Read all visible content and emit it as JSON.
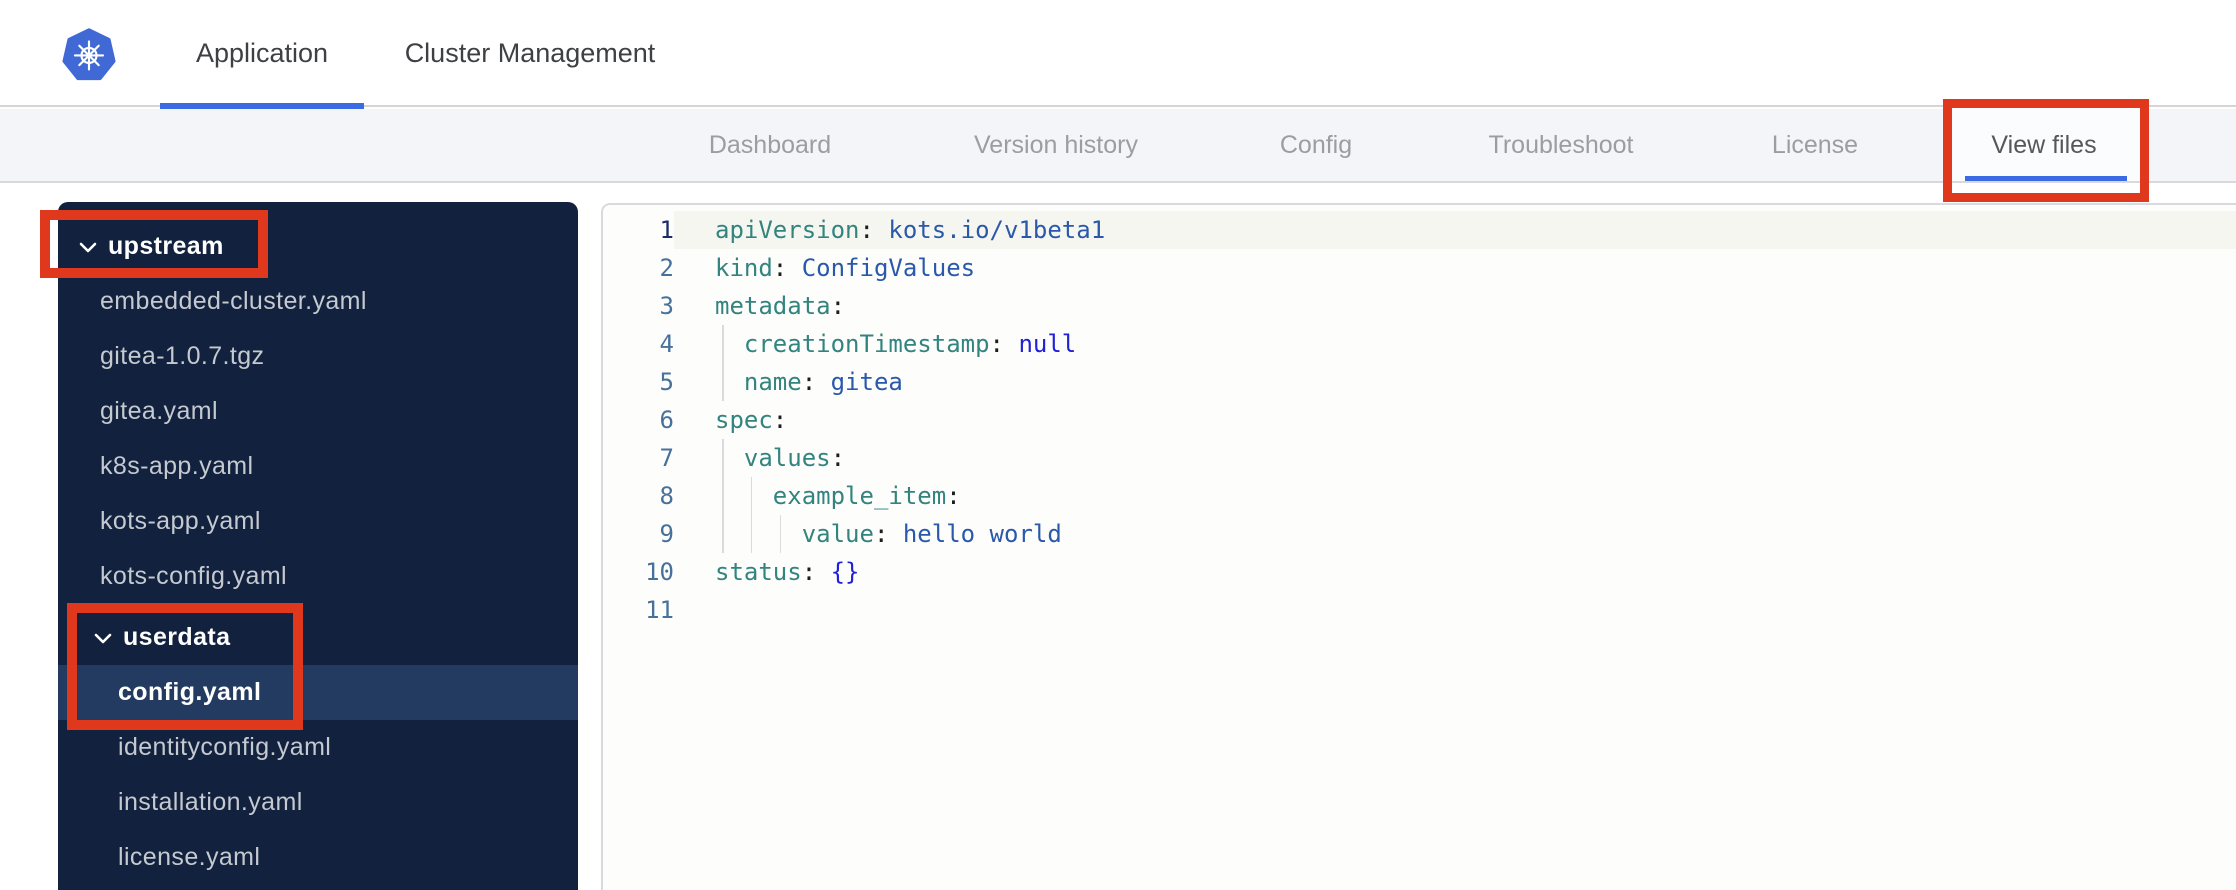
{
  "header": {
    "tabs": [
      {
        "label": "Application",
        "active": true
      },
      {
        "label": "Cluster Management",
        "active": false
      }
    ]
  },
  "nav": {
    "tabs": [
      {
        "label": "Dashboard",
        "active": false
      },
      {
        "label": "Version history",
        "active": false
      },
      {
        "label": "Config",
        "active": false
      },
      {
        "label": "Troubleshoot",
        "active": false
      },
      {
        "label": "License",
        "active": false
      },
      {
        "label": "View files",
        "active": true
      }
    ]
  },
  "file_tree": {
    "items": [
      {
        "label": "upstream",
        "type": "folder",
        "level": 0,
        "expanded": true,
        "selected": false,
        "annotated": true
      },
      {
        "label": "embedded-cluster.yaml",
        "type": "file",
        "level": 1,
        "selected": false
      },
      {
        "label": "gitea-1.0.7.tgz",
        "type": "file",
        "level": 1,
        "selected": false
      },
      {
        "label": "gitea.yaml",
        "type": "file",
        "level": 1,
        "selected": false
      },
      {
        "label": "k8s-app.yaml",
        "type": "file",
        "level": 1,
        "selected": false
      },
      {
        "label": "kots-app.yaml",
        "type": "file",
        "level": 1,
        "selected": false
      },
      {
        "label": "kots-config.yaml",
        "type": "file",
        "level": 1,
        "selected": false
      },
      {
        "label": "userdata",
        "type": "folder",
        "level": 1,
        "expanded": true,
        "selected": false,
        "annotated": true,
        "group_start": true
      },
      {
        "label": "config.yaml",
        "type": "file",
        "level": 2,
        "selected": true,
        "annotated": true
      },
      {
        "label": "identityconfig.yaml",
        "type": "file",
        "level": 2,
        "selected": false
      },
      {
        "label": "installation.yaml",
        "type": "file",
        "level": 2,
        "selected": false
      },
      {
        "label": "license.yaml",
        "type": "file",
        "level": 2,
        "selected": false
      }
    ]
  },
  "editor": {
    "file_shown": "config.yaml",
    "lines": [
      {
        "num": "1",
        "active": true,
        "guides": 0,
        "tokens": [
          [
            "k",
            "apiVersion"
          ],
          [
            "p",
            ":"
          ],
          [
            "s",
            " kots.io/v1beta1"
          ]
        ]
      },
      {
        "num": "2",
        "active": false,
        "guides": 0,
        "tokens": [
          [
            "k",
            "kind"
          ],
          [
            "p",
            ":"
          ],
          [
            "s",
            " ConfigValues"
          ]
        ]
      },
      {
        "num": "3",
        "active": false,
        "guides": 0,
        "tokens": [
          [
            "k",
            "metadata"
          ],
          [
            "p",
            ":"
          ]
        ]
      },
      {
        "num": "4",
        "active": false,
        "guides": 1,
        "tokens": [
          [
            "w",
            "  "
          ],
          [
            "k",
            "creationTimestamp"
          ],
          [
            "p",
            ":"
          ],
          [
            "a",
            " null"
          ]
        ]
      },
      {
        "num": "5",
        "active": false,
        "guides": 1,
        "tokens": [
          [
            "w",
            "  "
          ],
          [
            "k",
            "name"
          ],
          [
            "p",
            ":"
          ],
          [
            "s",
            " gitea"
          ]
        ]
      },
      {
        "num": "6",
        "active": false,
        "guides": 0,
        "tokens": [
          [
            "k",
            "spec"
          ],
          [
            "p",
            ":"
          ]
        ]
      },
      {
        "num": "7",
        "active": false,
        "guides": 1,
        "tokens": [
          [
            "w",
            "  "
          ],
          [
            "k",
            "values"
          ],
          [
            "p",
            ":"
          ]
        ]
      },
      {
        "num": "8",
        "active": false,
        "guides": 2,
        "tokens": [
          [
            "w",
            "    "
          ],
          [
            "k",
            "example_item"
          ],
          [
            "p",
            ":"
          ]
        ]
      },
      {
        "num": "9",
        "active": false,
        "guides": 3,
        "tokens": [
          [
            "w",
            "      "
          ],
          [
            "k",
            "value"
          ],
          [
            "p",
            ":"
          ],
          [
            "s",
            " hello world"
          ]
        ]
      },
      {
        "num": "10",
        "active": false,
        "guides": 0,
        "tokens": [
          [
            "k",
            "status"
          ],
          [
            "p",
            ":"
          ],
          [
            "a",
            " {}"
          ]
        ]
      },
      {
        "num": "11",
        "active": false,
        "guides": 0,
        "tokens": []
      }
    ]
  },
  "annotations": {
    "color": "#e0381d",
    "boxes": [
      {
        "target": "upstream-folder"
      },
      {
        "target": "userdata-folder-and-config-yaml"
      },
      {
        "target": "view-files-tab"
      }
    ]
  },
  "icons": {
    "logo": "kubernetes-logo",
    "folder_chevron": "chevron-down-icon"
  },
  "colors": {
    "accent_blue": "#3a6be4",
    "kubernetes_blue": "#4169d6",
    "annotation_red": "#e0381d",
    "sidebar_bg": "#12213d",
    "sidebar_selected_bg": "#233b60",
    "nav_bg": "#f4f5f8",
    "code_key": "#33847f",
    "code_string": "#2a58ab",
    "code_atom": "#2121d8",
    "line_number": "#47719a",
    "line_number_active": "#1d2c66"
  }
}
